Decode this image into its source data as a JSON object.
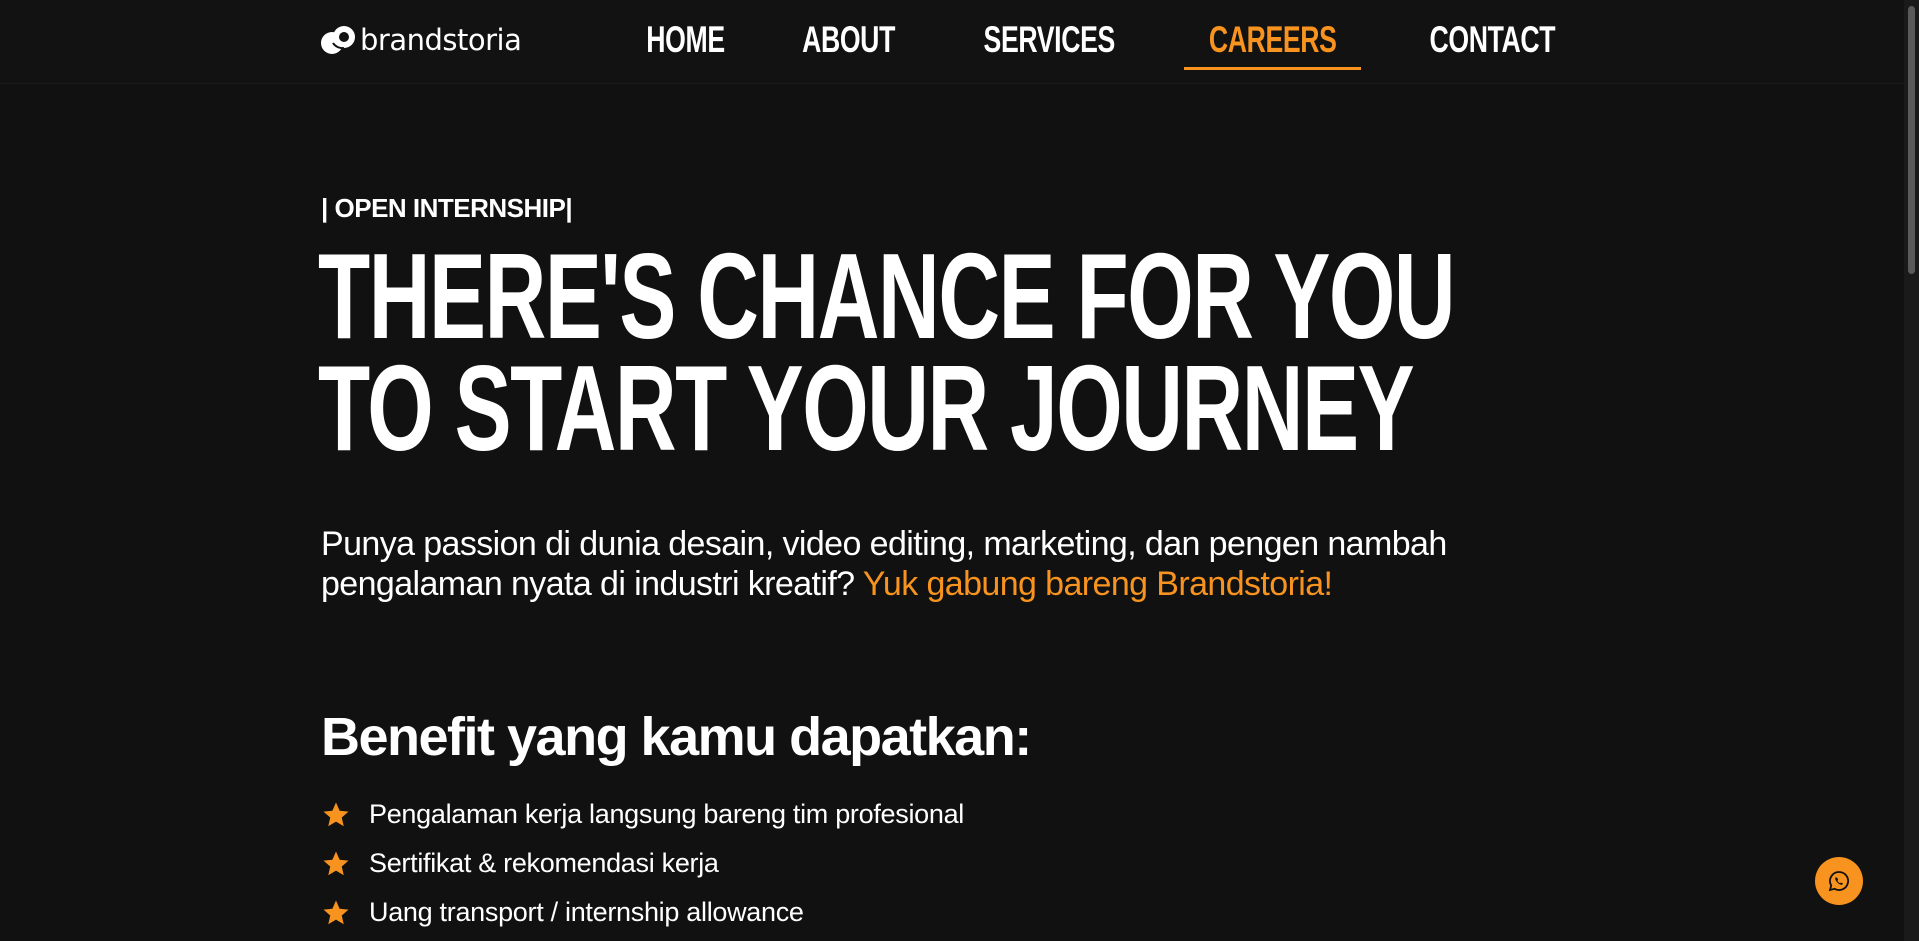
{
  "brand": {
    "name": "brandstoria",
    "logo_icon": "brand-logo-mark"
  },
  "nav": {
    "items": [
      {
        "label": "HOME",
        "active": false
      },
      {
        "label": "ABOUT",
        "active": false
      },
      {
        "label": "SERVICES",
        "active": false
      },
      {
        "label": "CAREERS",
        "active": true
      },
      {
        "label": "CONTACT",
        "active": false
      }
    ]
  },
  "hero": {
    "eyebrow": "| OPEN INTERNSHIP|",
    "headline_line1": "THERE'S CHANCE FOR YOU",
    "headline_line2": "TO START YOUR JOURNEY",
    "lead_text": "Punya passion di dunia desain, video editing, marketing, dan pengen nambah pengalaman nyata di industri kreatif?",
    "lead_accent": "Yuk gabung bareng Brandstoria!"
  },
  "benefits": {
    "title": "Benefit yang kamu dapatkan:",
    "icon": "star-icon",
    "items": [
      "Pengalaman kerja langsung bareng tim profesional",
      "Sertifikat & rekomendasi kerja",
      "Uang transport / internship allowance"
    ]
  },
  "floating": {
    "icon": "whatsapp-icon"
  },
  "colors": {
    "accent": "#f7931e",
    "background": "#111111",
    "text": "#ffffff"
  }
}
